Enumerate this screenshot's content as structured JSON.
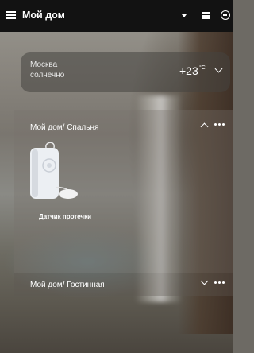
{
  "header": {
    "title": "Мой дом"
  },
  "weather": {
    "city": "Москва",
    "condition": "солнечно",
    "temp": "+23",
    "unit": "°C"
  },
  "rooms": [
    {
      "title": "Мой дом/ Спальня",
      "devices": [
        {
          "name": "Датчик протечки",
          "icon": "water-leak-sensor-icon"
        }
      ]
    },
    {
      "title": "Мой дом/ Гостинная"
    }
  ]
}
